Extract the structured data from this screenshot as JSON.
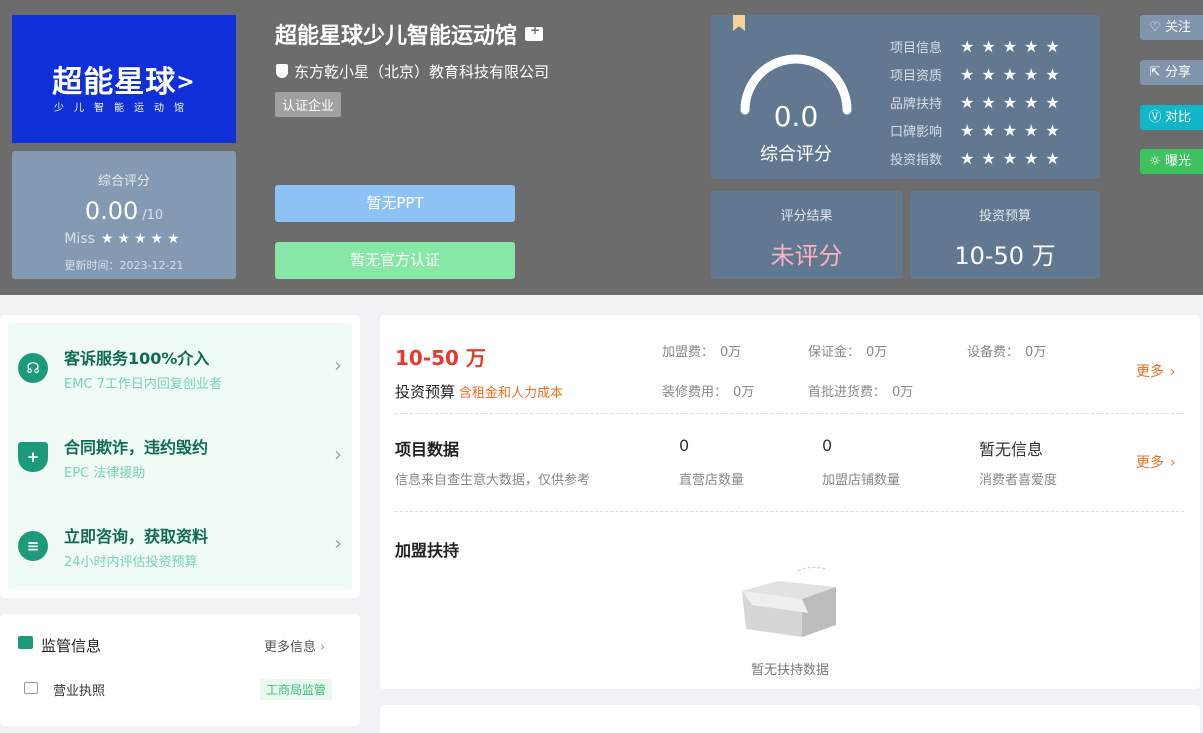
{
  "header": {
    "logo_text": "超能星球",
    "logo_arrow": ">",
    "logo_subtitle": "少儿智能运动馆",
    "title": "超能星球少儿智能运动馆",
    "company": "东方乾小星（北京）教育科技有限公司",
    "cert_tag": "认证企业",
    "btn_ppt": "暂无PPT",
    "btn_auth": "暂无官方认证"
  },
  "score_card": {
    "label": "综合评分",
    "value": "0.00",
    "denominator": "/10",
    "level": "Miss",
    "stars": "★★★★★",
    "updated": "更新时间：2023-12-21"
  },
  "overall": {
    "score": "0.0",
    "label": "综合评分",
    "metrics": [
      {
        "name": "项目信息",
        "stars": "★★★★★"
      },
      {
        "name": "项目资质",
        "stars": "★★★★★"
      },
      {
        "name": "品牌扶持",
        "stars": "★★★★★"
      },
      {
        "name": "口碑影响",
        "stars": "★★★★★"
      },
      {
        "name": "投资指数",
        "stars": "★★★★★"
      }
    ],
    "result_label": "评分结果",
    "result_value": "未评分",
    "budget_label": "投资预算",
    "budget_value": "10-50 万"
  },
  "side_actions": {
    "follow": "关注",
    "share": "分享",
    "compare": "对比",
    "expose": "曝光"
  },
  "services": [
    {
      "title": "客诉服务100%介入",
      "sub": "EMC 7工作日内回复创业者",
      "icon": "headset-icon",
      "glyph": "☊"
    },
    {
      "title": "合同欺诈，违约毁约",
      "sub": "EPC 法律援助",
      "icon": "shield-plus-icon",
      "glyph": "+"
    },
    {
      "title": "立即咨询，获取资料",
      "sub": "24小时内评估投资预算",
      "icon": "chat-icon",
      "glyph": "≡"
    }
  ],
  "regulation": {
    "title": "监管信息",
    "more": "更多信息",
    "license_label": "营业执照",
    "license_tag": "工商局监管"
  },
  "investment": {
    "value": "10-50 万",
    "label": "投资预算",
    "note": "含租金和人力成本",
    "fees": [
      {
        "name": "加盟费：",
        "value": "0万"
      },
      {
        "name": "保证金：",
        "value": "0万"
      },
      {
        "name": "设备费：",
        "value": "0万"
      },
      {
        "name": "装修费用：",
        "value": "0万"
      },
      {
        "name": "首批进货费：",
        "value": "0万"
      }
    ],
    "more": "更多"
  },
  "project_data": {
    "title": "项目数据",
    "sub": "信息来自查生意大数据，仅供参考",
    "stats": [
      {
        "value": "0",
        "label": "直营店数量"
      },
      {
        "value": "0",
        "label": "加盟店铺数量"
      },
      {
        "value": "暂无信息",
        "label": "消费者喜爱度"
      }
    ],
    "more": "更多"
  },
  "support": {
    "title": "加盟扶持",
    "empty": "暂无扶持数据"
  },
  "colors": {
    "banner": "#6c6c6c",
    "card": "#627890",
    "accent_red": "#e8392e",
    "accent_orange": "#ee6e1c",
    "service_green": "#1d9a7a"
  }
}
